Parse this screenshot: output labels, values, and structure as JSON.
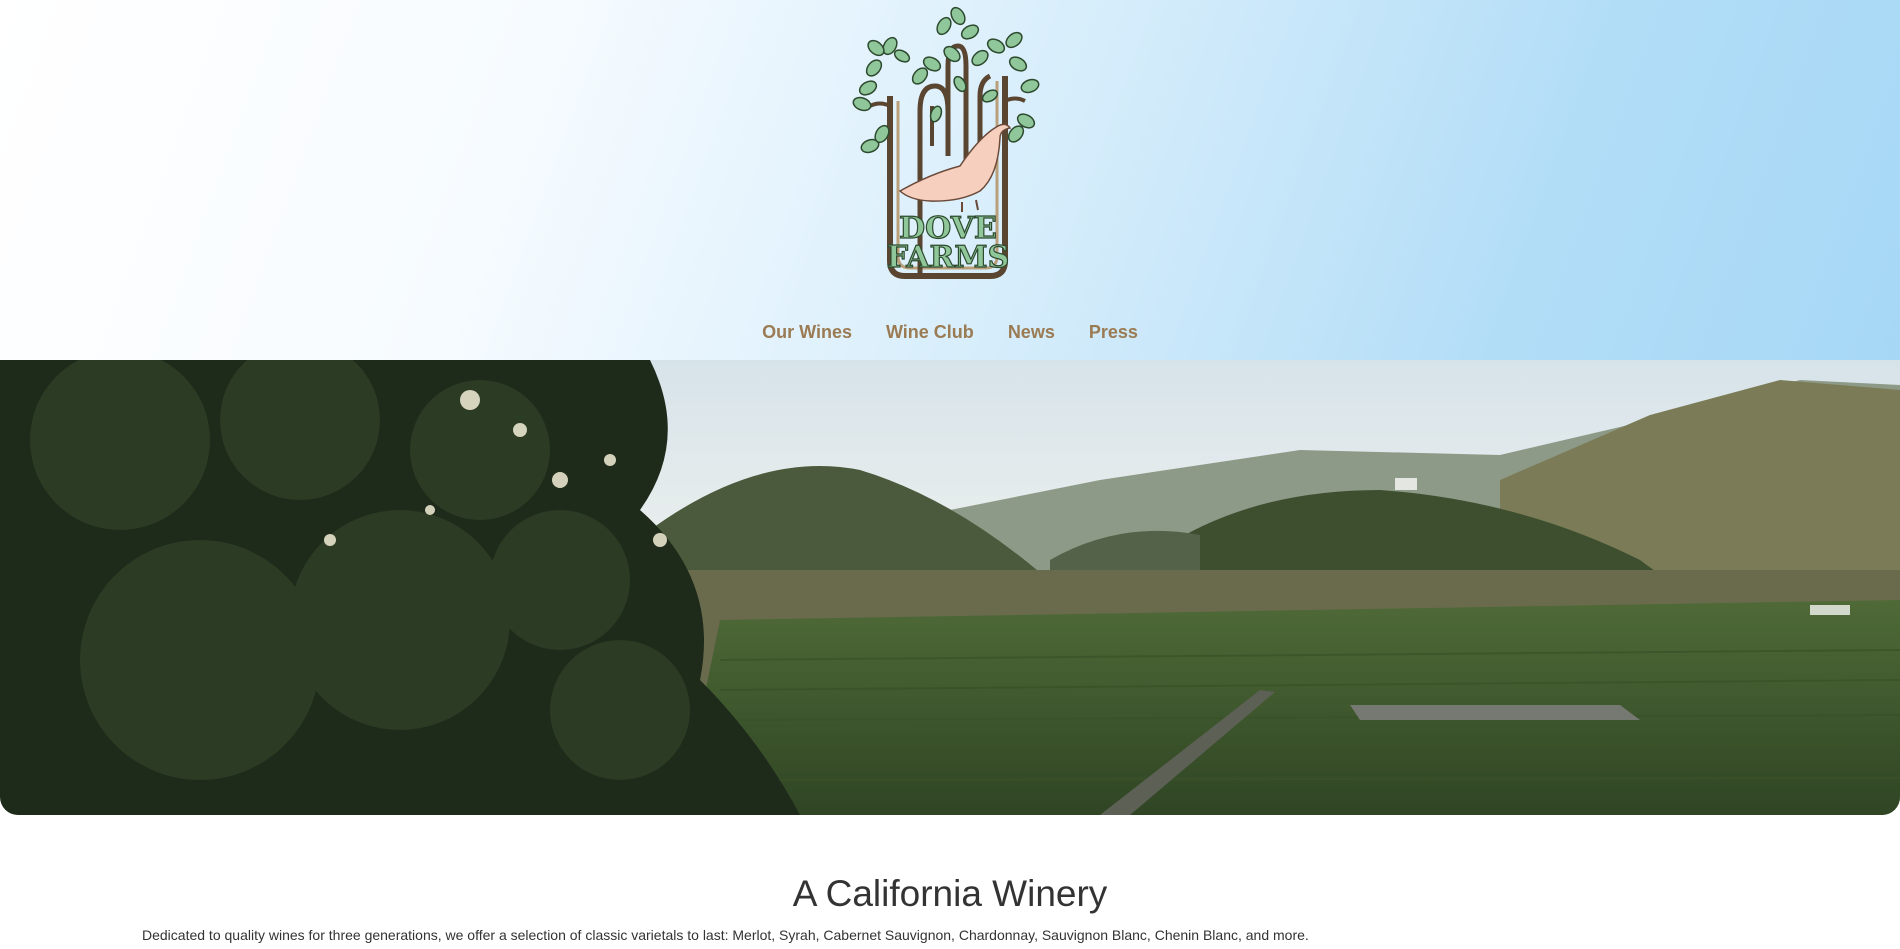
{
  "brand": {
    "logo_line1": "DOVE",
    "logo_line2": "FARMS",
    "colors": {
      "nav_text": "#9a7b53",
      "logo_green": "#8fc79a",
      "logo_brown": "#5a4530",
      "dove": "#f7cfbe"
    }
  },
  "nav": {
    "items": [
      {
        "label": "Our Wines"
      },
      {
        "label": "Wine Club"
      },
      {
        "label": "News"
      },
      {
        "label": "Press"
      }
    ]
  },
  "hero": {
    "icon": "vineyard-landscape-photo"
  },
  "main": {
    "title": "A California Winery",
    "intro": "Dedicated to quality wines for three generations, we offer a selection of classic varietals to last: Merlot, Syrah, Cabernet Sauvignon, Chardonnay, Sauvignon Blanc, Chenin Blanc, and more."
  }
}
